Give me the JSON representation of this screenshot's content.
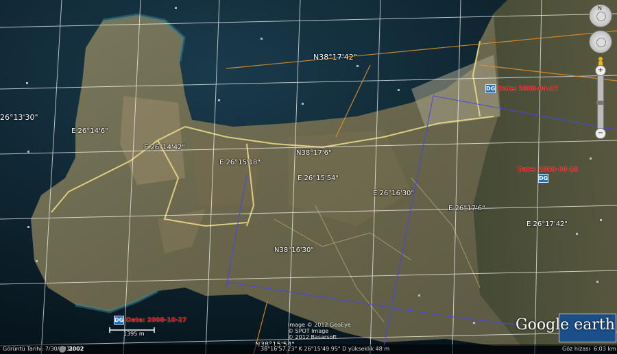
{
  "map": {
    "grid_labels": [
      {
        "text": "N38°17'42\"",
        "name": "lat-label-1"
      },
      {
        "text": "26°13'30\"",
        "name": "lon-label-left"
      },
      {
        "text": "E 26°14'6\"",
        "name": "lon-label-1"
      },
      {
        "text": "E 26°14'42\"",
        "name": "lon-label-2"
      },
      {
        "text": "E 26°15'18\"",
        "name": "lon-label-3"
      },
      {
        "text": "N38°17'6\"",
        "name": "lat-label-2"
      },
      {
        "text": "E 26°15'54\"",
        "name": "lon-label-4"
      },
      {
        "text": "E 26°16'30\"",
        "name": "lon-label-5"
      },
      {
        "text": "E 26°17'6\"",
        "name": "lon-label-6"
      },
      {
        "text": "E 26°17'42\"",
        "name": "lon-label-7"
      },
      {
        "text": "N38°16'30\"",
        "name": "lat-label-3"
      },
      {
        "text": "N38°15'54\"",
        "name": "lat-label-4"
      }
    ],
    "imagery_dates": [
      "Date: 2008-04-17",
      "Date: 2009-08-28",
      "Date: 2008-10-27"
    ],
    "dg_logo": "DG",
    "scale_label": "1395 m",
    "credits": [
      "Image © 2012 GeoEye",
      "© SPOT Image",
      "© 2012 Basarsoft"
    ],
    "logo_text": "Google earth"
  },
  "status_bar": {
    "imagery_date": "Görüntü Tarihi: 7/30/2011",
    "year_badge": "2002",
    "coordinates": "38°16'57.23\" K 26°15'49.95\" D  yükseklik   48 m",
    "eye_alt_label": "Göz hizası",
    "eye_alt_value": "6.03 km"
  },
  "nav": {
    "compass_letter": "N"
  },
  "colors": {
    "land": "#6e6a4c",
    "sea": "#0f2a3a",
    "road": "#e8d98a",
    "lat_line": "#e0902a",
    "boundary": "#4040d0",
    "date_text": "#d40000"
  }
}
